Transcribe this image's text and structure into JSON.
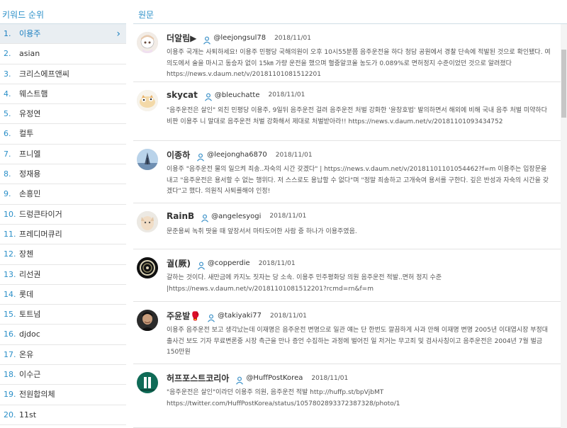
{
  "keywords": {
    "title": "키워드 순위",
    "items": [
      {
        "rank": "1.",
        "label": "이용주"
      },
      {
        "rank": "2.",
        "label": "asian"
      },
      {
        "rank": "3.",
        "label": "크리스에프앤씨"
      },
      {
        "rank": "4.",
        "label": "웨스트햄"
      },
      {
        "rank": "5.",
        "label": "유정연"
      },
      {
        "rank": "6.",
        "label": "컬투"
      },
      {
        "rank": "7.",
        "label": "프니엘"
      },
      {
        "rank": "8.",
        "label": "정재용"
      },
      {
        "rank": "9.",
        "label": "손흥민"
      },
      {
        "rank": "10.",
        "label": "드렁큰타이거"
      },
      {
        "rank": "11.",
        "label": "프레디머큐리"
      },
      {
        "rank": "12.",
        "label": "장첸"
      },
      {
        "rank": "13.",
        "label": "리선권"
      },
      {
        "rank": "14.",
        "label": "롯데"
      },
      {
        "rank": "15.",
        "label": "토트넘"
      },
      {
        "rank": "16.",
        "label": "djdoc"
      },
      {
        "rank": "17.",
        "label": "온유"
      },
      {
        "rank": "18.",
        "label": "이수근"
      },
      {
        "rank": "19.",
        "label": "전원합의체"
      },
      {
        "rank": "20.",
        "label": "11st"
      }
    ]
  },
  "source": {
    "title": "원문",
    "posts": [
      {
        "nick": "더알림▶",
        "handle": "@leejongsul78",
        "date": "2018/11/01",
        "text": "이용주 국개는 사퇴하세요! 이용주 민평당 국해의원이 오후 10시55분쯤 음주운전을 하다 청담 공원에서 경찰 단속에 적발된 것으로 확인됐다. 여의도에서 술을 마시고 동승자 없이 15㎞ 가량 운전을 했으며 혈중알코올 농도가 0.089%로 면허정지 수준이었던 것으로 알려졌다 https://news.v.daum.net/v/20181101081512201"
      },
      {
        "nick": "skycat",
        "handle": "@bleuchatte",
        "date": "2018/11/01",
        "text": "\"음주운전은 살인\" 외친 민평당 이용주, 9일뒤 음주운전 걸려 음주운전 처벌 강화한 '윤창호법' 발의하면서 해외에 비해 국내 음주 처벌 미약하다 비판 이용주 니 말대로 음주운전 처벌 강화해서 제대로 처벌받아라!! https://news.v.daum.net/v/20181101093434752"
      },
      {
        "nick": "이종하",
        "handle": "@leejongha6870",
        "date": "2018/11/01",
        "text": "이용주 \"음주운전 물의 일으켜 죄송..자숙의 시간 갖겠다\" | https://news.v.daum.net/v/20181101101054462?f=m 이용주는 입장문을 내고 \"음주운전은 용서할 수 없는 행위다. 저 스스로도 용납할 수 없다\"며 \"정말 죄송하고 고개숙여 용서를 구한다. 깊은 반성과 자숙의 시간을 갖겠다\"고 했다. 의원직 사퇴를해야 인정!"
      },
      {
        "nick": "RainB",
        "handle": "@angelesyogi",
        "date": "2018/11/01",
        "text": "문준용씨 녹취 땃을 때 앞장서서 마타도어한 사람 중 하나가 이용주였음."
      },
      {
        "nick": "궐(厥)",
        "handle": "@copperdie",
        "date": "2018/11/01",
        "text": "갈하는 것이다. 새만금에 카지노 짓자는 당 소속. 이용주 민주평화당 의원 음주운전 적발..면허 정지 수준 |https://news.v.daum.net/v/20181101081512201?rcmd=rn&f=m"
      },
      {
        "nick": "주윤발🥊",
        "handle": "@takiyaki77",
        "date": "2018/11/01",
        "text": "이용주 음주운전 보고 생각났는데 이재명은 음주운전 변명으로 일관 얘는 단 한번도 깔끔하게 사과 안해 이재명 변명 2005년 이대엽시장 부정대출사건 보도 기자 무료변론중 시장 측근을 만나 증언 수집하는 과정에 벌어진 일 저거는 무고죄 및 검사사칭이고 음주운전은 2004년 7월 벌금150만원"
      },
      {
        "nick": "허프포스트코리아",
        "handle": "@HuffPostKorea",
        "date": "2018/11/01",
        "text": "\"음주운전은 살인\"이라던 이용주 의원, 음주운전 적발 http://huffp.st/bpVjbMT https://twitter.com/HuffPostKorea/status/1057802893372387328/photo/1"
      }
    ]
  },
  "icons": {
    "user": "user-icon",
    "chevron": "chevron-right-icon"
  },
  "colors": {
    "accent": "#2a8fc8",
    "selected_bg": "#e9eef2"
  }
}
